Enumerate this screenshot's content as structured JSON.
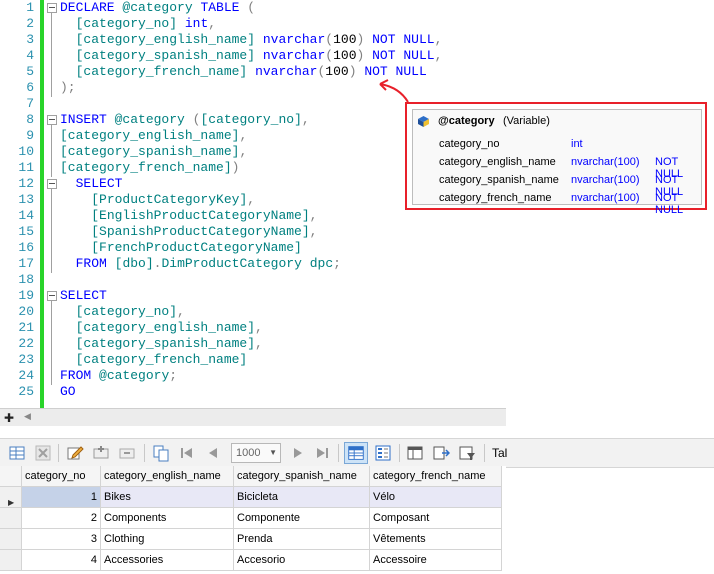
{
  "editor": {
    "lines": [
      {
        "n": "1",
        "html": "<span class='kw'>DECLARE</span> <span class='id'>@category</span> <span class='kw'>TABLE</span> <span class='gr'>(</span>"
      },
      {
        "n": "2",
        "html": "  <span class='id'>[category_no]</span> <span class='kw'>int</span><span class='gr'>,</span>"
      },
      {
        "n": "3",
        "html": "  <span class='id'>[category_english_name]</span> <span class='kw'>nvarchar</span><span class='gr'>(</span>100<span class='gr'>)</span> <span class='kw'>NOT</span> <span class='kw'>NULL</span><span class='gr'>,</span>"
      },
      {
        "n": "4",
        "html": "  <span class='id'>[category_spanish_name]</span> <span class='kw'>nvarchar</span><span class='gr'>(</span>100<span class='gr'>)</span> <span class='kw'>NOT</span> <span class='kw'>NULL</span><span class='gr'>,</span>"
      },
      {
        "n": "5",
        "html": "  <span class='id'>[category_french_name]</span> <span class='kw'>nvarchar</span><span class='gr'>(</span>100<span class='gr'>)</span> <span class='kw'>NOT</span> <span class='kw'>NULL</span>"
      },
      {
        "n": "6",
        "html": "<span class='gr'>);</span>"
      },
      {
        "n": "7",
        "html": ""
      },
      {
        "n": "8",
        "html": "<span class='kw'>INSERT</span> <span class='id'>@category</span> <span class='gr'>(</span><span class='id'>[category_no]</span><span class='gr'>,</span>"
      },
      {
        "n": "9",
        "html": "<span class='id'>[category_english_name]</span><span class='gr'>,</span>"
      },
      {
        "n": "10",
        "html": "<span class='id'>[category_spanish_name]</span><span class='gr'>,</span>"
      },
      {
        "n": "11",
        "html": "<span class='id'>[category_french_name]</span><span class='gr'>)</span>"
      },
      {
        "n": "12",
        "html": "  <span class='kw'>SELECT</span>"
      },
      {
        "n": "13",
        "html": "    <span class='id'>[ProductCategoryKey]</span><span class='gr'>,</span>"
      },
      {
        "n": "14",
        "html": "    <span class='id'>[EnglishProductCategoryName]</span><span class='gr'>,</span>"
      },
      {
        "n": "15",
        "html": "    <span class='id'>[SpanishProductCategoryName]</span><span class='gr'>,</span>"
      },
      {
        "n": "16",
        "html": "    <span class='id'>[FrenchProductCategoryName]</span>"
      },
      {
        "n": "17",
        "html": "  <span class='kw'>FROM</span> <span class='id'>[dbo]</span><span class='gr'>.</span><span class='id'>DimProductCategory</span> <span class='id'>dpc</span><span class='gr'>;</span>"
      },
      {
        "n": "18",
        "html": ""
      },
      {
        "n": "19",
        "html": "<span class='kw'>SELECT</span>"
      },
      {
        "n": "20",
        "html": "  <span class='id'>[category_no]</span><span class='gr'>,</span>"
      },
      {
        "n": "21",
        "html": "  <span class='id'>[category_english_name]</span><span class='gr'>,</span>"
      },
      {
        "n": "22",
        "html": "  <span class='id'>[category_spanish_name]</span><span class='gr'>,</span>"
      },
      {
        "n": "23",
        "html": "  <span class='id'>[category_french_name]</span>"
      },
      {
        "n": "24",
        "html": "<span class='kw'>FROM</span> <span class='id'>@category</span><span class='gr'>;</span>"
      },
      {
        "n": "25",
        "html": "<span class='kw'>GO</span>"
      }
    ]
  },
  "tooltip": {
    "name": "@category",
    "kind": "(Variable)",
    "rows": [
      {
        "col": "category_no",
        "type": "int",
        "nullable": ""
      },
      {
        "col": "category_english_name",
        "type": "nvarchar(100)",
        "nullable": "NOT NULL"
      },
      {
        "col": "category_spanish_name",
        "type": "nvarchar(100)",
        "nullable": "NOT NULL"
      },
      {
        "col": "category_french_name",
        "type": "nvarchar(100)",
        "nullable": "NOT NULL"
      }
    ]
  },
  "toolbar": {
    "page_size": "1000",
    "truncated_label": "Tal"
  },
  "grid": {
    "columns": [
      "category_no",
      "category_english_name",
      "category_spanish_name",
      "category_french_name"
    ],
    "rows": [
      [
        "1",
        "Bikes",
        "Bicicleta",
        "Vélo"
      ],
      [
        "2",
        "Components",
        "Componente",
        "Composant"
      ],
      [
        "3",
        "Clothing",
        "Prenda",
        "Vêtements"
      ],
      [
        "4",
        "Accessories",
        "Accesorio",
        "Accessoire"
      ]
    ]
  },
  "colors": {
    "keyword": "#0000ff",
    "identifier": "#008080",
    "line_number": "#2b91af",
    "modified_bar": "#29d42a",
    "highlight_border": "#e8202a"
  }
}
